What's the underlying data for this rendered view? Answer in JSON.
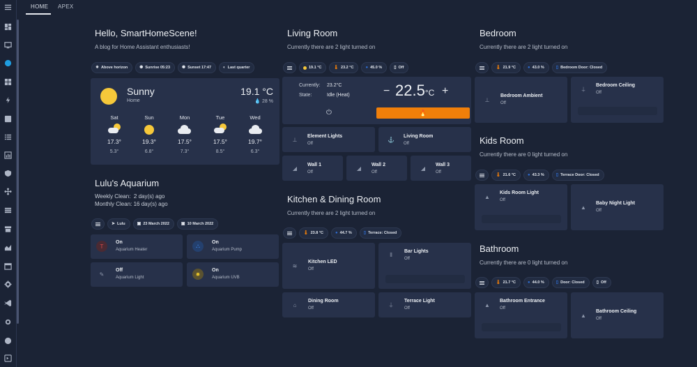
{
  "tabs": [
    {
      "label": "HOME"
    },
    {
      "label": "APEX"
    }
  ],
  "sidebar_icons": [
    "menu-icon",
    "dashboard-icon",
    "monitor-icon",
    "palette-icon",
    "widgets-icon",
    "lightning-icon",
    "person-card-icon",
    "list-icon",
    "chart-icon",
    "shield-icon",
    "network-icon",
    "layers-icon",
    "storefront-icon",
    "area-chart-icon",
    "calendar-icon",
    "gear-icon",
    "vscode-icon",
    "settings-icon",
    "compass-icon",
    "terminal-icon"
  ],
  "hello": {
    "title": "Hello, SmartHomeScene!",
    "subtitle": "A blog for Home Assistant enthusiasts!",
    "chips": [
      "Above horizon",
      "Sunrise 05:23",
      "Sunset 17:47",
      "Last quarter"
    ]
  },
  "weather": {
    "condition": "Sunny",
    "location": "Home",
    "temp": "19.1 °C",
    "humidity": "28 %",
    "forecast": [
      {
        "day": "Sat",
        "hi": "17.3°",
        "lo": "5.3°",
        "icon": "partly-cloudy-icon"
      },
      {
        "day": "Sun",
        "hi": "19.3°",
        "lo": "6.8°",
        "icon": "sunny-icon"
      },
      {
        "day": "Mon",
        "hi": "17.5°",
        "lo": "7.3°",
        "icon": "cloudy-icon"
      },
      {
        "day": "Tue",
        "hi": "17.5°",
        "lo": "8.5°",
        "icon": "partly-cloudy-icon"
      },
      {
        "day": "Wed",
        "hi": "19.7°",
        "lo": "6.3°",
        "icon": "cloudy-icon"
      }
    ]
  },
  "aquarium": {
    "title": "Lulu's Aquarium",
    "weekly": "Weekly Clean:",
    "weekly_val": "2 day(s) ago",
    "monthly": "Monthly Clean:",
    "monthly_val": "16 day(s) ago",
    "chips": [
      "Lulu",
      "23 March 2022",
      "10 March 2022"
    ],
    "tiles": [
      {
        "state": "On",
        "name": "Aquarium Heater",
        "color": "#c83a3a"
      },
      {
        "state": "On",
        "name": "Aquarium Pump",
        "color": "#2f6fd6"
      },
      {
        "state": "Off",
        "name": "Aquarium Light",
        "color": "#8d97ab"
      },
      {
        "state": "On",
        "name": "Aquarium UVB",
        "color": "#e6c22a"
      }
    ]
  },
  "living": {
    "title": "Living Room",
    "subtitle": "Currently there are 2 light turned on",
    "chips": [
      "19.1 °C",
      "23.2 °C",
      "45.0 %",
      "Off"
    ],
    "thermostat": {
      "current_label": "Currently:",
      "current": "23.2°C",
      "state_label": "State:",
      "state": "Idle (Heat)",
      "minus": "−",
      "target": "22.5",
      "unit": "°C",
      "plus": "+"
    },
    "tiles": [
      {
        "name": "Element Lights",
        "state": "Off"
      },
      {
        "name": "Living Room",
        "state": "Off"
      },
      {
        "name": "Wall 1",
        "state": "Off"
      },
      {
        "name": "Wall 2",
        "state": "Off"
      },
      {
        "name": "Wall 3",
        "state": "Off"
      }
    ]
  },
  "kitchen": {
    "title": "Kitchen & Dining Room",
    "subtitle": "Currently there are 2 light turned on",
    "chips": [
      "23.8 °C",
      "44.7 %",
      "Terrace: Closed"
    ],
    "tiles": [
      {
        "name": "Kitchen LED",
        "state": "Off"
      },
      {
        "name": "Bar Lights",
        "state": "Off"
      },
      {
        "name": "Dining Room",
        "state": "Off"
      },
      {
        "name": "Terrace Light",
        "state": "Off"
      }
    ]
  },
  "bedroom": {
    "title": "Bedroom",
    "subtitle": "Currently there are 2 light turned on",
    "chips": [
      "21.9 °C",
      "43.0 %",
      "Bedroom Door: Closed"
    ],
    "tiles": [
      {
        "name": "Bedroom Ambient",
        "state": "Off"
      },
      {
        "name": "Bedroom Ceiling",
        "state": "Off"
      }
    ]
  },
  "kids": {
    "title": "Kids Room",
    "subtitle": "Currently there are 0 light turned on",
    "chips": [
      "21.6 °C",
      "43.3 %",
      "Terrace Door: Closed"
    ],
    "tiles": [
      {
        "name": "Kids Room Light",
        "state": "Off"
      },
      {
        "name": "Baby Night Light",
        "state": "Off"
      }
    ]
  },
  "bathroom": {
    "title": "Bathroom",
    "subtitle": "Currently there are 0 light turned on",
    "chips": [
      "21.7 °C",
      "44.0 %",
      "Door: Closed",
      "Off"
    ],
    "tiles": [
      {
        "name": "Bathroom Entrance",
        "state": "Off"
      },
      {
        "name": "Bathroom Ceiling",
        "state": "Off"
      }
    ]
  },
  "colors": {
    "background": "#1b2335",
    "card": "#27314a",
    "accent": "#1f9de0",
    "heat": "#f07f0a",
    "sun": "#f6c83a"
  }
}
